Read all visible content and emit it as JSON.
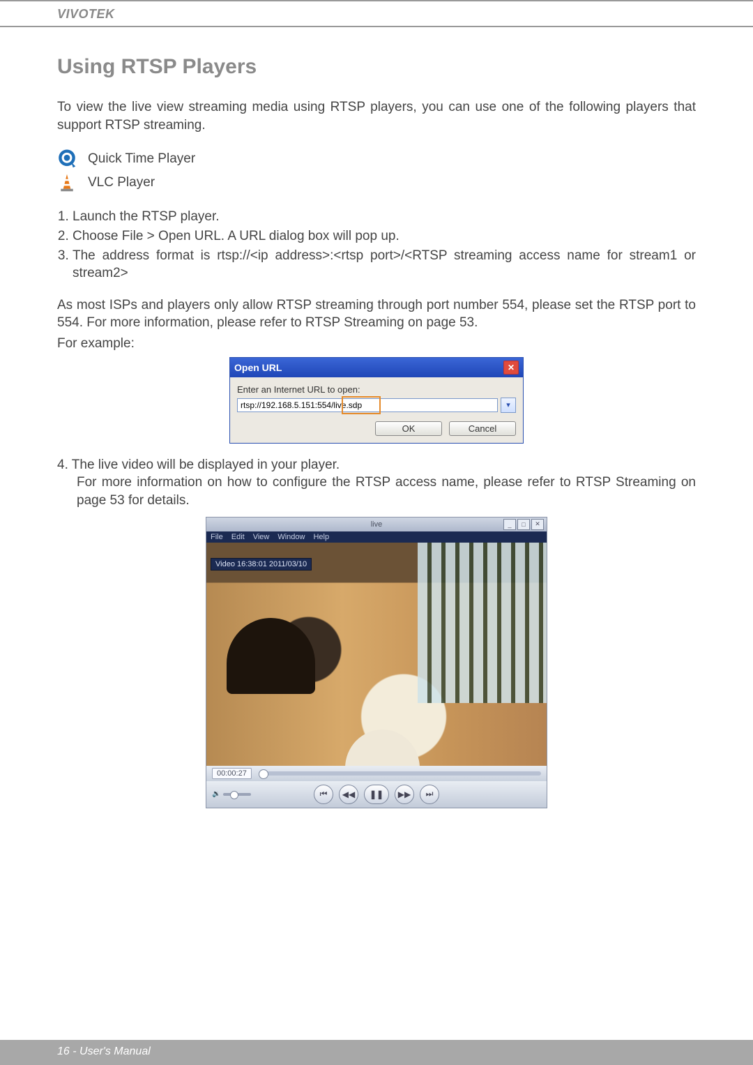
{
  "brand": "VIVOTEK",
  "section_title": "Using RTSP Players",
  "intro": "To view the live view streaming media using RTSP players, you can use one of the following players that support RTSP streaming.",
  "players": {
    "quicktime": "Quick Time Player",
    "vlc": "VLC Player"
  },
  "steps": {
    "s1": "Launch the RTSP player.",
    "s2": "Choose File > Open URL. A URL dialog box will pop up.",
    "s3": "The address format is rtsp://<ip address>:<rtsp port>/<RTSP streaming access name for stream1 or stream2>"
  },
  "note": "As most ISPs and players only allow RTSP streaming through port number 554, please set the RTSP port to 554. For more information, please refer to RTSP Streaming on page 53.",
  "for_example": "For example:",
  "dialog": {
    "title": "Open URL",
    "prompt": "Enter an Internet URL to open:",
    "url_value": "rtsp://192.168.5.151:554/live.sdp",
    "ok": "OK",
    "cancel": "Cancel"
  },
  "step4": {
    "line1": "4. The live video will be displayed in your player.",
    "line2": "For more information on how to configure the RTSP access name, please refer to RTSP Streaming on page 53 for details."
  },
  "qt": {
    "window_title": "live",
    "menus": {
      "file": "File",
      "edit": "Edit",
      "view": "View",
      "window": "Window",
      "help": "Help"
    },
    "overlay": "Video 16:38:01 2011/03/10",
    "timecode": "00:00:27"
  },
  "footer": "16 - User's Manual"
}
